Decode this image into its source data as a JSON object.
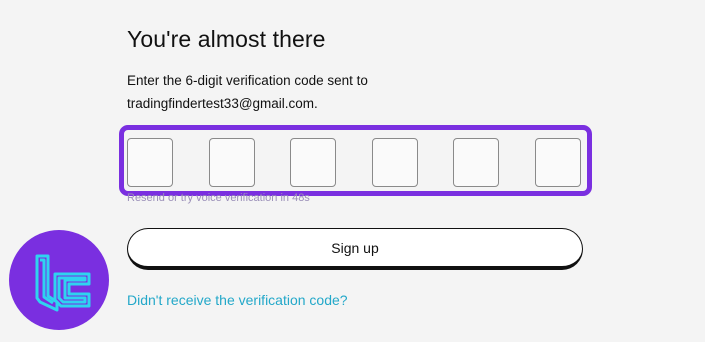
{
  "heading": "You're almost there",
  "instruction": {
    "line1": "Enter the 6-digit verification code sent to",
    "line2": "tradingfindertest33@gmail.com."
  },
  "code_inputs": [
    "",
    "",
    "",
    "",
    "",
    ""
  ],
  "resend_text": "Resend or try voice verification in 48s",
  "signup_label": "Sign up",
  "didnt_receive_link": "Didn't receive the verification code?",
  "logo_icon": "tradingfinder-logo-icon",
  "colors": {
    "accent_purple": "#7a2fe0",
    "link_teal": "#23a8c9",
    "logo_stroke": "#2fd3f0"
  }
}
